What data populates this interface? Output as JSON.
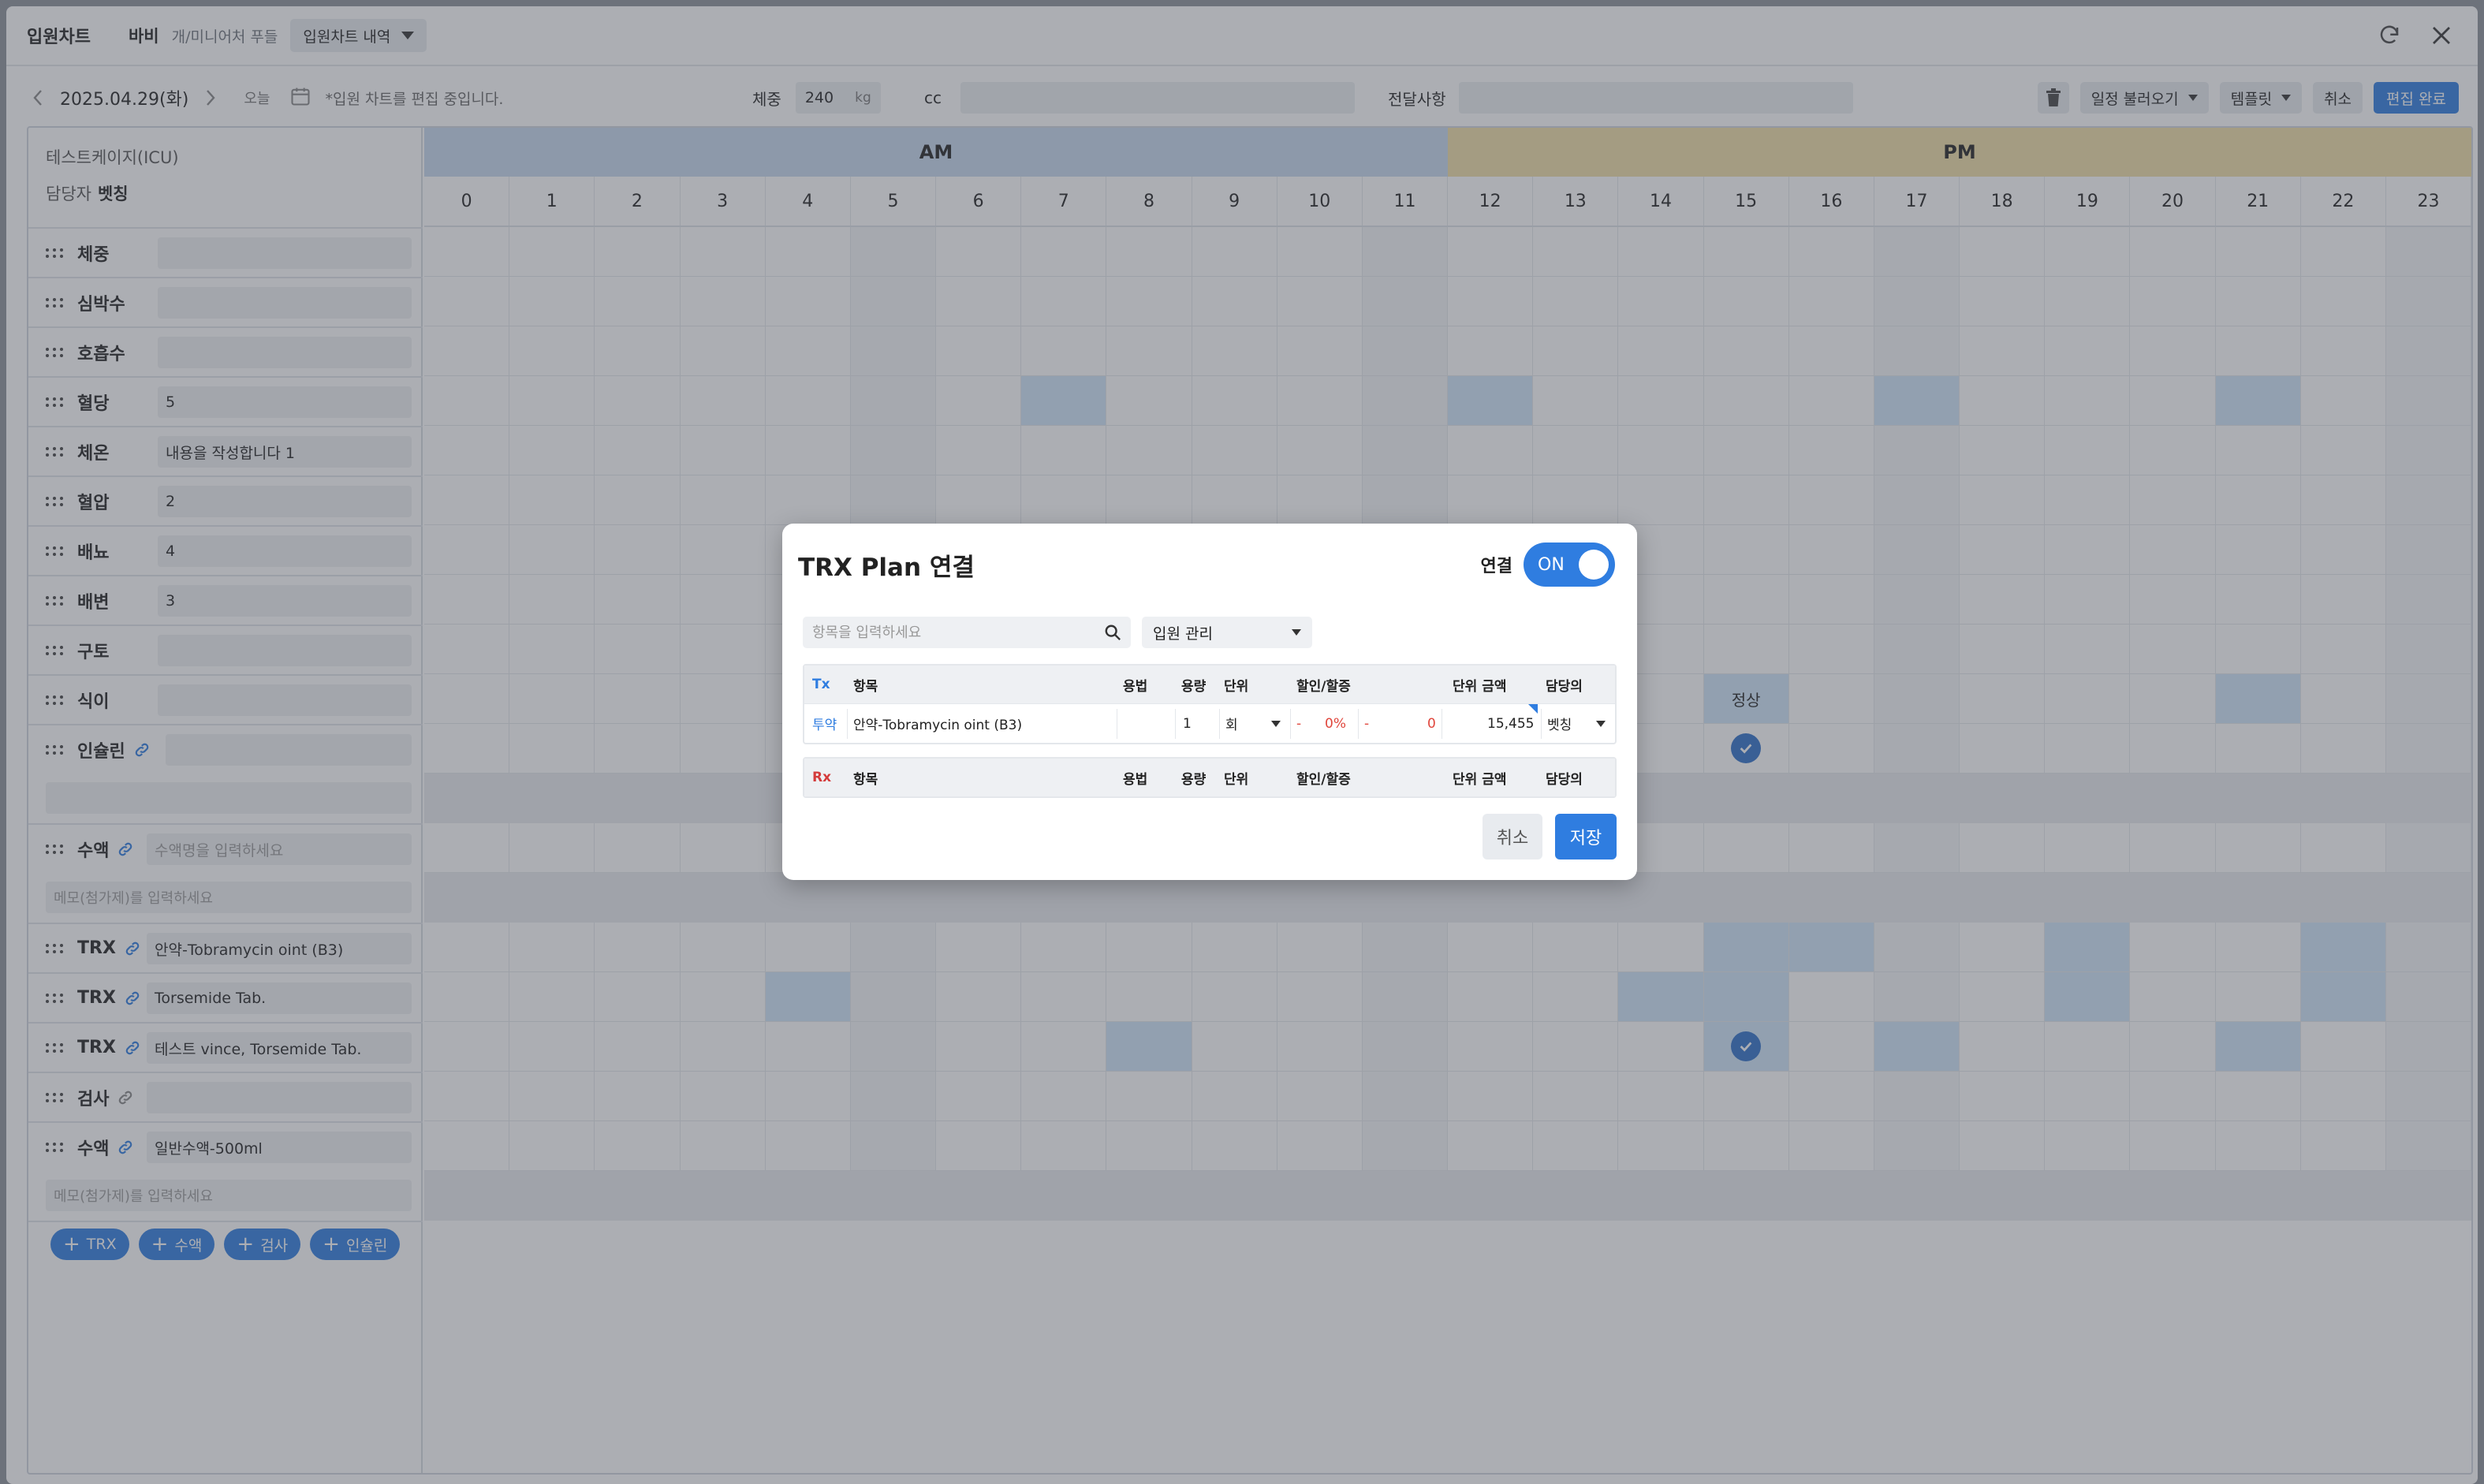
{
  "titlebar": {
    "title": "입원차트",
    "patient_name": "바비",
    "patient_breed": "개/미니어처 푸들",
    "history_dropdown": "입원차트 내역"
  },
  "toolbar": {
    "date": "2025.04.29(화)",
    "today": "오늘",
    "edit_note": "*입원 차트를 편집 중입니다.",
    "weight_label": "체중",
    "weight_value": "240",
    "weight_unit": "kg",
    "cc_label": "cc",
    "cc_value": "",
    "message_label": "전달사항",
    "message_value": "",
    "load_schedule": "일정 불러오기",
    "template": "템플릿",
    "cancel": "취소",
    "finish_edit": "편집 완료"
  },
  "chart": {
    "ward": "테스트케이지(ICU)",
    "doctor_label": "담당자",
    "doctor_name": "벳칭",
    "am_label": "AM",
    "pm_label": "PM",
    "hours": [
      "0",
      "1",
      "2",
      "3",
      "4",
      "5",
      "6",
      "7",
      "8",
      "9",
      "10",
      "11",
      "12",
      "13",
      "14",
      "15",
      "16",
      "17",
      "18",
      "19",
      "20",
      "21",
      "22",
      "23"
    ],
    "rows": [
      {
        "name": "체중",
        "value": "",
        "placeholder": ""
      },
      {
        "name": "심박수",
        "value": "",
        "placeholder": ""
      },
      {
        "name": "호흡수",
        "value": "",
        "placeholder": ""
      },
      {
        "name": "혈당",
        "value": "5",
        "placeholder": ""
      },
      {
        "name": "체온",
        "value": "내용을 작성합니다 1",
        "placeholder": ""
      },
      {
        "name": "혈압",
        "value": "2",
        "placeholder": ""
      },
      {
        "name": "배뇨",
        "value": "4",
        "placeholder": ""
      },
      {
        "name": "배변",
        "value": "3",
        "placeholder": ""
      },
      {
        "name": "구토",
        "value": "",
        "placeholder": ""
      },
      {
        "name": "식이",
        "value": "",
        "placeholder": ""
      },
      {
        "name": "인슐린",
        "value": "",
        "placeholder": ""
      },
      {
        "name": "수액",
        "value": "",
        "placeholder": "수액명을 입력하세요",
        "memo": "메모(첨가제)를 입력하세요"
      },
      {
        "name": "TRX",
        "value": "안약-Tobramycin oint (B3)",
        "placeholder": ""
      },
      {
        "name": "TRX",
        "value": "Torsemide Tab.",
        "placeholder": ""
      },
      {
        "name": "TRX",
        "value": "테스트 vince, Torsemide Tab.",
        "placeholder": ""
      },
      {
        "name": "검사",
        "value": "",
        "placeholder": ""
      },
      {
        "name": "수액",
        "value": "일반수액-500ml",
        "placeholder": "",
        "memo": "메모(첨가제)를 입력하세요"
      }
    ],
    "diet_cell_text": "정상",
    "add_buttons": [
      "TRX",
      "수액",
      "검사",
      "인슐린"
    ]
  },
  "modal": {
    "title": "TRX Plan 연결",
    "link_label": "연결",
    "toggle": "ON",
    "search_placeholder": "항목을 입력하세요",
    "category": "입원 관리",
    "tx_header": {
      "tag": "Tx",
      "item": "항목",
      "usage": "용법",
      "dose": "용량",
      "unit": "단위",
      "discount": "할인/할증",
      "price": "단위 금액",
      "doctor": "담당의"
    },
    "tx_row": {
      "tag": "투약",
      "item": "안약-Tobramycin oint (B3)",
      "usage": "",
      "dose": "1",
      "unit": "회",
      "discount_sign": "-",
      "discount_pct": "0%",
      "surcharge_sign": "-",
      "surcharge": "0",
      "price": "15,455",
      "doctor": "벳칭"
    },
    "rx_header": {
      "tag": "Rx",
      "item": "항목",
      "usage": "용법",
      "dose": "용량",
      "unit": "단위",
      "discount": "할인/할증",
      "price": "단위 금액",
      "doctor": "담당의"
    },
    "cancel": "취소",
    "save": "저장"
  },
  "colors": {
    "accent": "#2f7de0",
    "am_header": "#c6d9ee",
    "pm_header": "#f1dfa6",
    "highlight_cell": "#cfe6fa",
    "rx_red": "#d43b3b"
  }
}
